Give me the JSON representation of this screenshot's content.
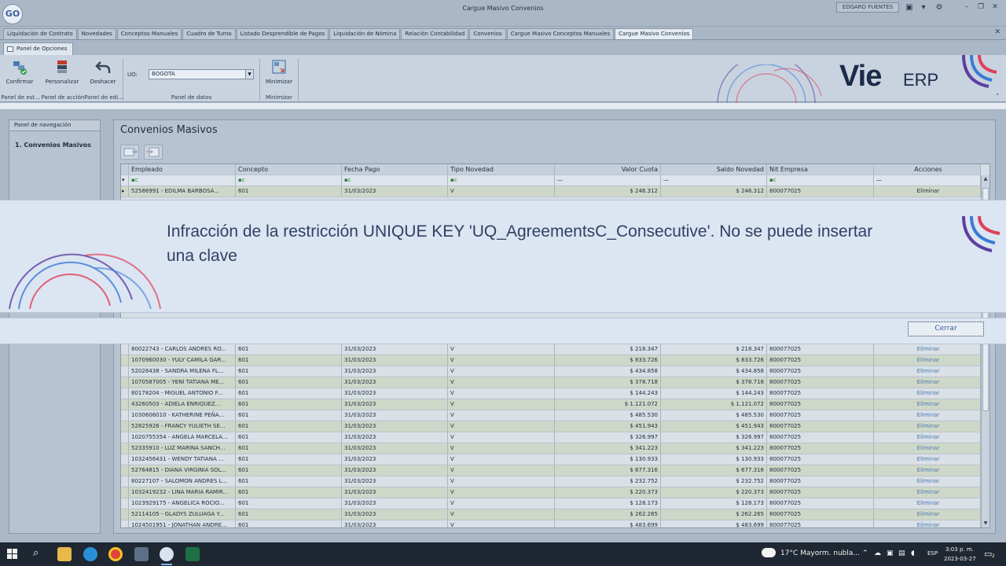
{
  "window": {
    "title": "Cargue Masivo Convenios",
    "logo_text": "GO",
    "user": "EDGARD FUENTES"
  },
  "module_tabs": [
    {
      "label": "Liquidación de Contrato",
      "active": false
    },
    {
      "label": "Novedades",
      "active": false
    },
    {
      "label": "Conceptos Manuales",
      "active": false
    },
    {
      "label": "Cuadro de Turno",
      "active": false
    },
    {
      "label": "Listado Desprendible de Pagos",
      "active": false
    },
    {
      "label": "Liquidación de Nómina",
      "active": false
    },
    {
      "label": "Relación Contabilidad",
      "active": false
    },
    {
      "label": "Convenios",
      "active": false
    },
    {
      "label": "Cargue Masivo Conceptos Manuales",
      "active": false
    },
    {
      "label": "Cargue Masivo Convenios",
      "active": true
    }
  ],
  "ribbon": {
    "tab": "Panel de Opciones",
    "buttons": {
      "confirmar": "Confirmar",
      "personalizar": "Personalizar",
      "deshacer": "Deshacer",
      "minimizar": "Minimizar"
    },
    "groups": {
      "estado": "Panel de est...",
      "accion": "Panel de acción",
      "edicion": "Panel de edi...",
      "datos": "Panel de datos",
      "minimizar": "Minimizar"
    },
    "uo_label": "UO:",
    "uo_value": "BOGOTA",
    "brand": {
      "vie": "Vie",
      "erp": "ERP"
    }
  },
  "nav": {
    "title": "Panel de navegación",
    "item": "1. Convenios Masivos"
  },
  "content": {
    "title": "Convenios Masivos"
  },
  "grid": {
    "columns": [
      "Empleado",
      "Concepto",
      "Fecha Pago",
      "Tipo Novedad",
      "Valor Cuota",
      "Saldo Novedad",
      "Nit Empresa",
      "Acciones"
    ],
    "filter_glyph": "—",
    "rows": [
      {
        "emp": "52586991 - EDILMA  BARBOSA...",
        "con": "601",
        "fec": "31/03/2023",
        "tip": "V",
        "val": "$ 246.312",
        "sal": "$ 246.312",
        "nit": "800077025",
        "acc": "Eliminar"
      },
      {
        "emp": "80022743 - CARLOS ANDRES RO...",
        "con": "601",
        "fec": "31/03/2023",
        "tip": "V",
        "val": "$ 218.347",
        "sal": "$ 218.347",
        "nit": "800077025",
        "acc": "Eliminar"
      },
      {
        "emp": "1070960030 - YULY CAMILA GAR...",
        "con": "601",
        "fec": "31/03/2023",
        "tip": "V",
        "val": "$ 833.726",
        "sal": "$ 833.726",
        "nit": "800077025",
        "acc": "Eliminar"
      },
      {
        "emp": "52026438 - SANDRA MILENA FL...",
        "con": "601",
        "fec": "31/03/2023",
        "tip": "V",
        "val": "$ 434.858",
        "sal": "$ 434.858",
        "nit": "800077025",
        "acc": "Eliminar"
      },
      {
        "emp": "1070587005 - YENI TATIANA ME...",
        "con": "601",
        "fec": "31/03/2023",
        "tip": "V",
        "val": "$ 378.718",
        "sal": "$ 378.718",
        "nit": "800077025",
        "acc": "Eliminar"
      },
      {
        "emp": "80178204 - MIGUEL ANTONIO F...",
        "con": "601",
        "fec": "31/03/2023",
        "tip": "V",
        "val": "$ 144.243",
        "sal": "$ 144.243",
        "nit": "800077025",
        "acc": "Eliminar"
      },
      {
        "emp": "43260503 - ADIELA  ENRIQUEZ...",
        "con": "601",
        "fec": "31/03/2023",
        "tip": "V",
        "val": "$ 1.121.072",
        "sal": "$ 1.121.072",
        "nit": "800077025",
        "acc": "Eliminar"
      },
      {
        "emp": "1030606010 - KATHERINE  PEÑA...",
        "con": "601",
        "fec": "31/03/2023",
        "tip": "V",
        "val": "$ 485.530",
        "sal": "$ 485.530",
        "nit": "800077025",
        "acc": "Eliminar"
      },
      {
        "emp": "52825926 - FRANCY YULIETH SE...",
        "con": "601",
        "fec": "31/03/2023",
        "tip": "V",
        "val": "$ 451.943",
        "sal": "$ 451.943",
        "nit": "800077025",
        "acc": "Eliminar"
      },
      {
        "emp": "1020755354 - ANGELA MARCELA...",
        "con": "601",
        "fec": "31/03/2023",
        "tip": "V",
        "val": "$ 326.997",
        "sal": "$ 326.997",
        "nit": "800077025",
        "acc": "Eliminar"
      },
      {
        "emp": "52335910 - LUZ MARINA SANCH...",
        "con": "601",
        "fec": "31/03/2023",
        "tip": "V",
        "val": "$ 341.223",
        "sal": "$ 341.223",
        "nit": "800077025",
        "acc": "Eliminar"
      },
      {
        "emp": "1032456431 - WENDY TATIANA ...",
        "con": "601",
        "fec": "31/03/2023",
        "tip": "V",
        "val": "$ 130.933",
        "sal": "$ 130.933",
        "nit": "800077025",
        "acc": "Eliminar"
      },
      {
        "emp": "52764815 - DIANA VIRGINIA SOL...",
        "con": "601",
        "fec": "31/03/2023",
        "tip": "V",
        "val": "$ 677.316",
        "sal": "$ 677.316",
        "nit": "800077025",
        "acc": "Eliminar"
      },
      {
        "emp": "80227107 - SALOMON ANDRES L...",
        "con": "601",
        "fec": "31/03/2023",
        "tip": "V",
        "val": "$ 232.752",
        "sal": "$ 232.752",
        "nit": "800077025",
        "acc": "Eliminar"
      },
      {
        "emp": "1032419232 - LINA MARIA RAMIR...",
        "con": "601",
        "fec": "31/03/2023",
        "tip": "V",
        "val": "$ 220.373",
        "sal": "$ 220.373",
        "nit": "800077025",
        "acc": "Eliminar"
      },
      {
        "emp": "1023929175 - ANGELICA ROCIO...",
        "con": "601",
        "fec": "31/03/2023",
        "tip": "V",
        "val": "$ 128.173",
        "sal": "$ 128.173",
        "nit": "800077025",
        "acc": "Eliminar"
      },
      {
        "emp": "52114105 - GLADYS  ZULUAGA Y...",
        "con": "601",
        "fec": "31/03/2023",
        "tip": "V",
        "val": "$ 262.265",
        "sal": "$ 262.265",
        "nit": "800077025",
        "acc": "Eliminar"
      },
      {
        "emp": "1024501951 - JONATHAN ANDRE...",
        "con": "601",
        "fec": "31/03/2023",
        "tip": "V",
        "val": "$ 483.699",
        "sal": "$ 483.699",
        "nit": "800077025",
        "acc": "Eliminar"
      }
    ]
  },
  "error": {
    "message": "Infracción de la restricción UNIQUE KEY 'UQ_AgreementsC_Consecutive'. No se puede insertar una clave",
    "close_label": "Cerrar"
  },
  "taskbar": {
    "weather": "17°C  Mayorm. nubla...",
    "lang": "ESP",
    "time": "3:03 p. m.",
    "date": "2023-03-27",
    "notifications": "2"
  },
  "colors": {
    "brand_navy": "#1b2b4a",
    "arc_red": "#e0405a",
    "arc_blue": "#3a7bd5",
    "arc_purple": "#5b3fa0",
    "link_blue": "#4a78b0"
  }
}
